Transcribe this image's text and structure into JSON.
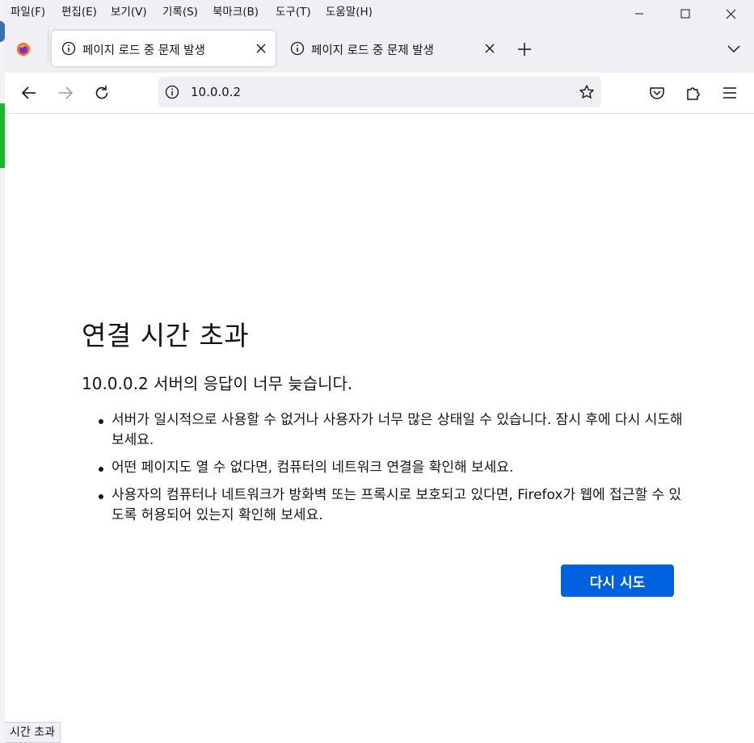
{
  "window": {
    "menu": [
      "파일(F)",
      "편집(E)",
      "보기(V)",
      "기록(S)",
      "북마크(B)",
      "도구(T)",
      "도움말(H)"
    ],
    "controls": {
      "minimize": "minimize-icon",
      "maximize": "maximize-icon",
      "close": "close-icon"
    }
  },
  "tabs": [
    {
      "title": "페이지 로드 중 문제 발생",
      "active": true,
      "icon": "info-icon"
    },
    {
      "title": "페이지 로드 중 문제 발생",
      "active": false,
      "icon": "info-icon"
    }
  ],
  "navbar": {
    "url": "10.0.0.2",
    "icons": [
      "back-icon",
      "forward-icon",
      "reload-icon",
      "info-icon",
      "star-icon",
      "pocket-icon",
      "extensions-icon",
      "menu-icon"
    ]
  },
  "error": {
    "title": "연결 시간 초과",
    "description": "10.0.0.2 서버의 응답이 너무 늦습니다.",
    "bullets": [
      "서버가 일시적으로 사용할 수 없거나 사용자가 너무 많은 상태일 수 있습니다. 잠시 후에 다시 시도해 보세요.",
      "어떤 페이지도 열 수 없다면, 컴퓨터의 네트워크 연결을 확인해 보세요.",
      "사용자의 컴퓨터나 네트워크가 방화벽 또는 프록시로 보호되고 있다면, Firefox가 웹에 접근할 수 있도록 허용되어 있는지 확인해 보세요."
    ],
    "retry_label": "다시 시도"
  },
  "status": "시간 초과",
  "colors": {
    "accent": "#0061e0",
    "chrome": "#f0f0f4",
    "text": "#15141a"
  }
}
